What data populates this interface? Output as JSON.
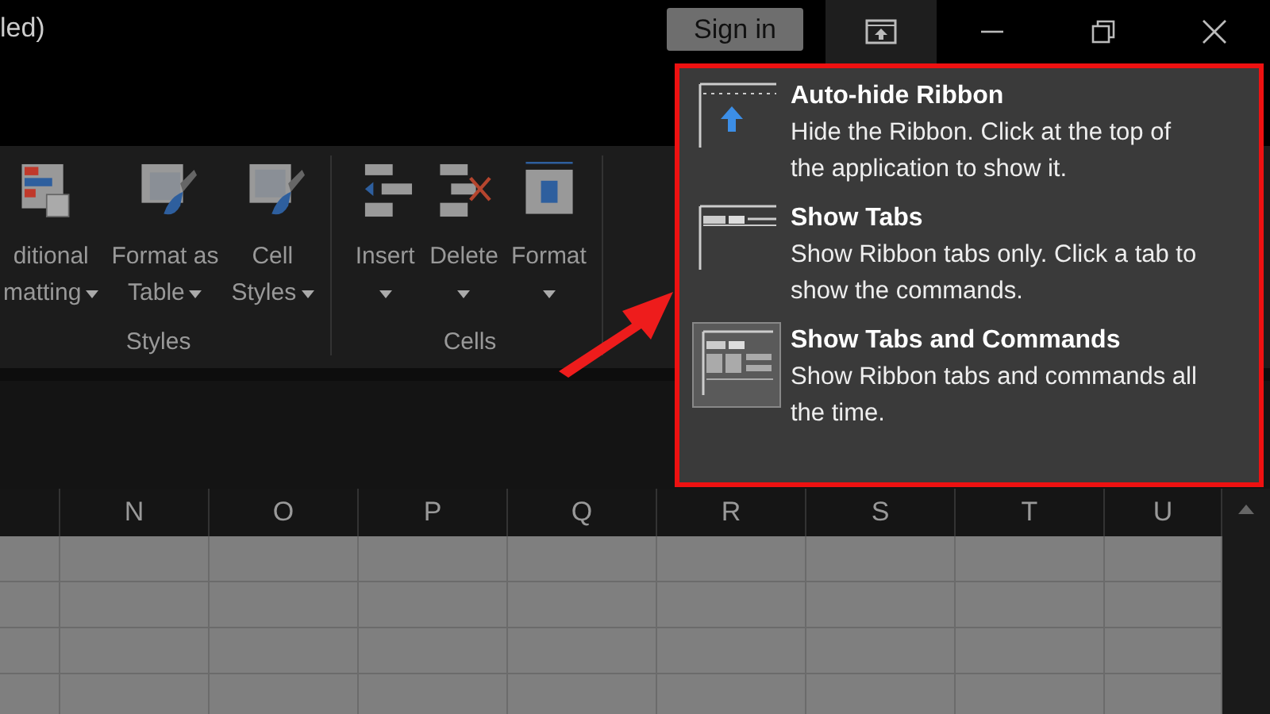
{
  "window": {
    "title": "led)"
  },
  "sign_in": "Sign in",
  "title_buttons": [
    {
      "kind": "ribbon-options",
      "selected": true
    },
    {
      "kind": "minimize",
      "selected": false
    },
    {
      "kind": "restore",
      "selected": false
    },
    {
      "kind": "close",
      "selected": false
    }
  ],
  "ribbon": {
    "groups": [
      {
        "label": "Styles",
        "commands": [
          {
            "kind": "conditional",
            "lines": [
              "ditional",
              "matting"
            ]
          },
          {
            "kind": "table",
            "lines": [
              "Format as",
              "Table"
            ]
          },
          {
            "kind": "cellstyles",
            "lines": [
              "Cell",
              "Styles"
            ]
          }
        ]
      },
      {
        "label": "Cells",
        "commands": [
          {
            "kind": "insert",
            "lines": [
              "Insert"
            ]
          },
          {
            "kind": "delete",
            "lines": [
              "Delete"
            ]
          },
          {
            "kind": "format",
            "lines": [
              "Format"
            ]
          }
        ]
      }
    ]
  },
  "columns": [
    "N",
    "O",
    "P",
    "Q",
    "R",
    "S",
    "T",
    "U"
  ],
  "menu": {
    "items": [
      {
        "kind": "autohide",
        "title": "Auto-hide Ribbon",
        "description": "Hide the Ribbon. Click at the top of the application to show it.",
        "selected": false
      },
      {
        "kind": "tabs",
        "title": "Show Tabs",
        "description": "Show Ribbon tabs only. Click a tab to show the commands.",
        "selected": false
      },
      {
        "kind": "tabscommands",
        "title": "Show Tabs and Commands",
        "description": "Show Ribbon tabs and commands all the time.",
        "selected": true
      }
    ]
  }
}
